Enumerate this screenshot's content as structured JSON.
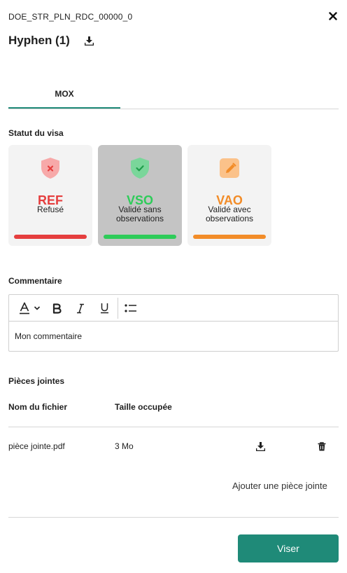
{
  "header": {
    "document_name": "DOE_STR_PLN_RDC_00000_0",
    "title": "Hyphen (1)",
    "icons": {
      "close": "close-icon",
      "download": "download-icon"
    }
  },
  "tabs": [
    {
      "label": "MOX",
      "active": true
    }
  ],
  "visa": {
    "section_label": "Statut du visa",
    "selected": "VSO",
    "options": [
      {
        "code": "REF",
        "label": "Refusé",
        "color": "#e53e3e",
        "icon": "shield-x-icon"
      },
      {
        "code": "VSO",
        "label": "Validé sans observations",
        "color": "#2ecc59",
        "icon": "shield-check-icon"
      },
      {
        "code": "VAO",
        "label": "Validé avec observations",
        "color": "#f28c28",
        "icon": "pencil-icon"
      }
    ]
  },
  "comment": {
    "section_label": "Commentaire",
    "value": "Mon commentaire",
    "toolbar": [
      "text-color-icon",
      "chevron-down-icon",
      "bold-icon",
      "italic-icon",
      "underline-icon",
      "bullet-list-icon"
    ]
  },
  "attachments": {
    "section_label": "Pièces jointes",
    "columns": [
      "Nom du fichier",
      "Taille occupée"
    ],
    "rows": [
      {
        "name": "pièce jointe.pdf",
        "size": "3 Mo"
      }
    ],
    "add_label": "Ajouter une pièce jointe"
  },
  "actions": {
    "submit_label": "Viser",
    "accent_color": "#1f8a78"
  }
}
